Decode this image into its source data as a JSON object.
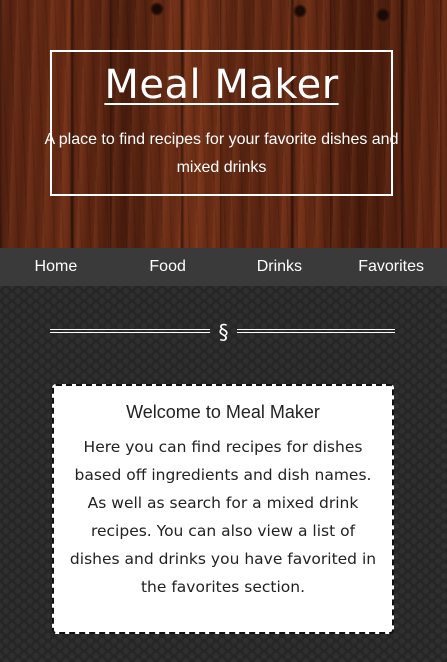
{
  "hero": {
    "title": "Meal Maker",
    "subtitle": "A place to find recipes for your favorite dishes and mixed drinks"
  },
  "nav": {
    "items": [
      "Home",
      "Food",
      "Drinks",
      "Favorites"
    ]
  },
  "divider": {
    "symbol": "§"
  },
  "welcome": {
    "title": "Welcome to Meal Maker",
    "text": "Here you can find recipes for dishes based off ingredients and dish names. As well as search for a mixed drink recipes. You can also view a list of dishes and drinks you have favorited in the favorites section."
  },
  "colors": {
    "nav_bg": "#3a3a3a",
    "page_bg": "#262626",
    "card_bg": "#ffffff"
  }
}
